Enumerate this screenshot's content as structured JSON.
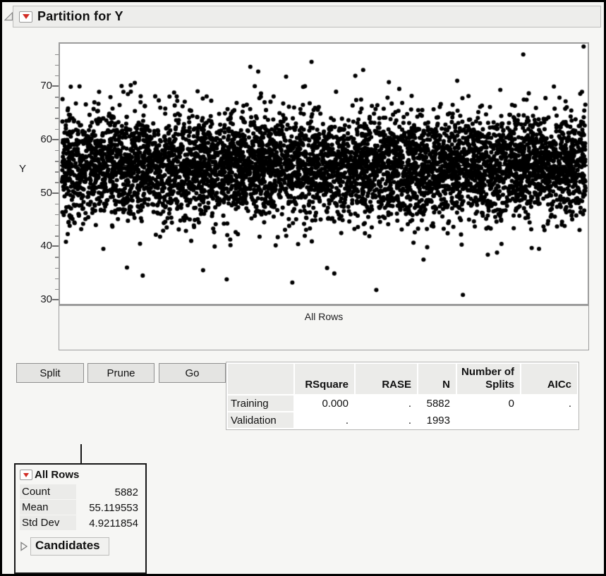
{
  "window": {
    "title": "Partition for Y"
  },
  "plot": {
    "y_axis_label": "Y",
    "x_category_label": "All Rows"
  },
  "chart_data": {
    "type": "scatter",
    "title": "Partition for Y",
    "ylabel": "Y",
    "xlabel": "All Rows",
    "yticks": [
      70,
      60,
      50,
      40,
      30
    ],
    "ylim": [
      29.5,
      78.0
    ],
    "grid": false,
    "n_points": 5882,
    "distribution": {
      "mean": 55.119553,
      "std_dev": 4.9211854
    },
    "mean_line": 55.119553,
    "outlier_points": [
      [
        0.08,
        39.5
      ],
      [
        0.125,
        36.0
      ],
      [
        0.155,
        34.5
      ],
      [
        0.27,
        35.5
      ],
      [
        0.315,
        33.8
      ],
      [
        0.44,
        33.2
      ],
      [
        0.52,
        34.9
      ],
      [
        0.6,
        31.8
      ],
      [
        0.765,
        30.9
      ],
      [
        0.69,
        37.5
      ],
      [
        0.83,
        38.8
      ],
      [
        0.91,
        39.5
      ],
      [
        0.36,
        73.6
      ],
      [
        0.375,
        72.7
      ],
      [
        0.56,
        71.9
      ],
      [
        0.575,
        73.0
      ],
      [
        0.88,
        75.9
      ],
      [
        0.995,
        77.4
      ]
    ]
  },
  "controls": {
    "split": "Split",
    "prune": "Prune",
    "go": "Go"
  },
  "summary_table": {
    "columns": [
      "",
      "RSquare",
      "RASE",
      "N",
      "Number of Splits",
      "AICc"
    ],
    "rows": [
      {
        "label": "Training",
        "values": [
          "0.000",
          ".",
          "5882",
          "0",
          "."
        ]
      },
      {
        "label": "Validation",
        "values": [
          ".",
          ".",
          "1993",
          "",
          ""
        ]
      }
    ]
  },
  "node": {
    "title": "All Rows",
    "stats": [
      {
        "label": "Count",
        "value": "5882"
      },
      {
        "label": "Mean",
        "value": "55.119553"
      },
      {
        "label": "Std Dev",
        "value": "4.9211854"
      }
    ],
    "candidates_label": "Candidates"
  },
  "colors": {
    "accent_red": "#d22d26",
    "panel_bg": "#f6f6f4",
    "frame_border": "#9c9c9c",
    "point": "#000000"
  }
}
